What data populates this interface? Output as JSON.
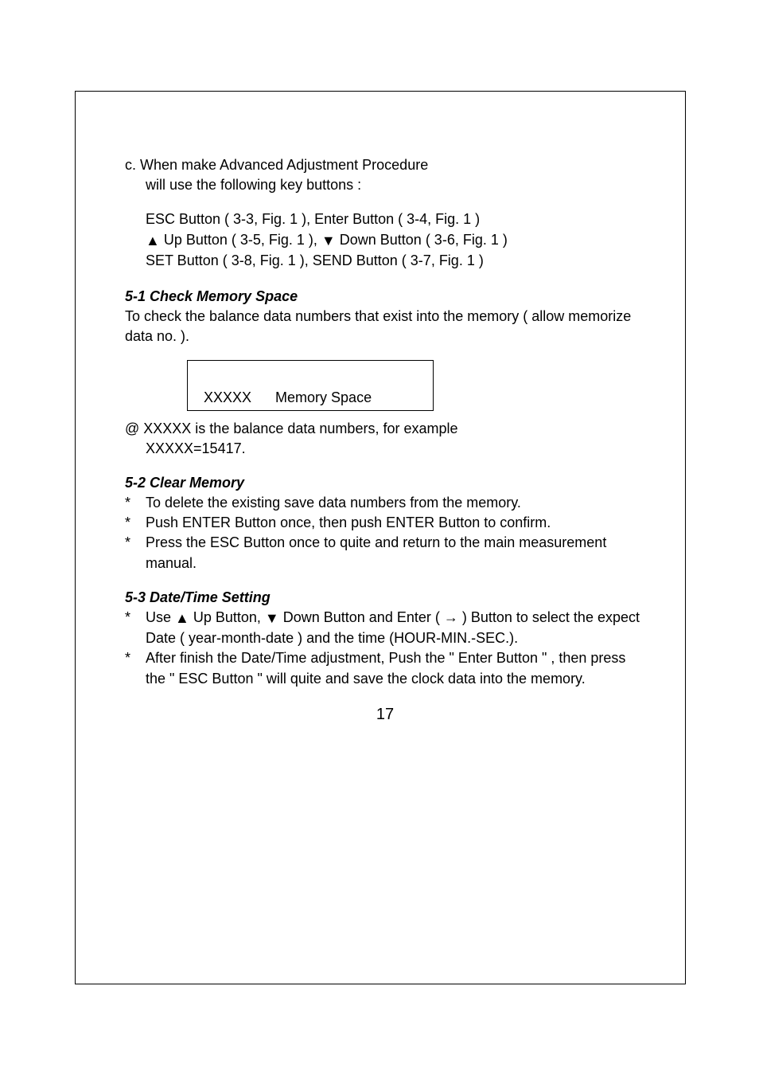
{
  "sectionC": {
    "line1": "c. When make Advanced Adjustment Procedure",
    "line2": "will use the following key buttons :"
  },
  "buttons": {
    "line1": "ESC Button ( 3-3, Fig. 1 ),  Enter Button ( 3-4, Fig. 1 )",
    "up_prefix": "▲",
    "line2a": " Up Button ( 3-5, Fig. 1 ), ",
    "down_prefix": "▼",
    "line2b": " Down Button ( 3-6, Fig. 1 )",
    "line3": "SET Button ( 3-8, Fig. 1 ), SEND Button ( 3-7, Fig. 1 )"
  },
  "s51": {
    "heading": "5-1 Check Memory Space",
    "body": "To check the balance data numbers that exist into the memory ( allow memorize data no. ).",
    "box": "XXXXX      Memory Space",
    "note1": "@ XXXXX is the balance data numbers, for example",
    "note2": "XXXXX=15417."
  },
  "s52": {
    "heading": "5-2 Clear Memory",
    "b1": "To delete the existing save data numbers from the memory.",
    "b2": "Push ENTER Button once, then push ENTER Button to confirm.",
    "b3": "Press the ESC Button once to quite and return to the main measurement manual."
  },
  "s53": {
    "heading": "5-3 Date/Time Setting",
    "b1_pre": "Use ",
    "b1_mid1": " Up Button, ",
    "b1_mid2": " Down Button and Enter ( ",
    "arrow": "→",
    "b1_post": " )  Button to select the expect Date ( year-month-date ) and the time  (HOUR-MIN.-SEC.).",
    "b2": "After finish the Date/Time adjustment, Push the \" Enter Button \" , then press the \" ESC Button \" will quite and save the clock data into the memory."
  },
  "pageNum": "17"
}
